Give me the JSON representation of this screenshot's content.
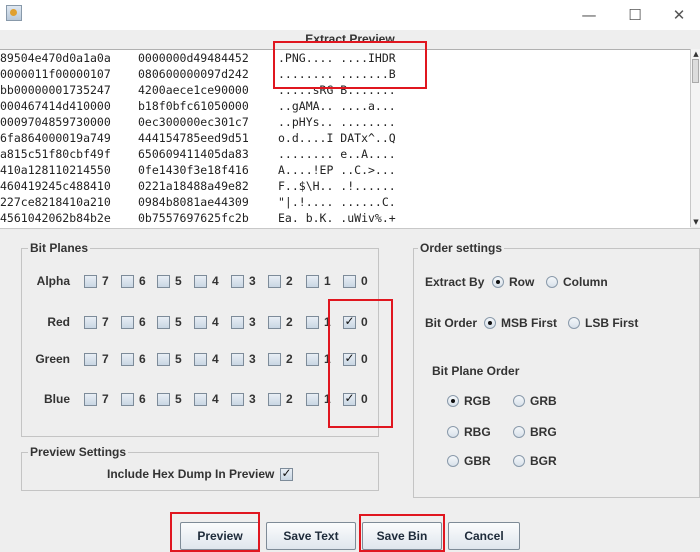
{
  "window": {
    "min_glyph": "—",
    "max_glyph": "☐",
    "close_glyph": "✕"
  },
  "preview": {
    "title": "Extract Preview",
    "rows": [
      [
        "89504e470d0a1a0a",
        "0000000d49484452",
        ".PNG.... ....IHDR"
      ],
      [
        "0000011f00000107",
        "080600000097d242",
        "........ .......B"
      ],
      [
        "bb00000001735247",
        "4200aece1ce90000",
        ".....sRG B......."
      ],
      [
        "000467414d410000",
        "b18f0bfc61050000",
        "..gAMA.. ....a..."
      ],
      [
        "0009704859730000",
        "0ec300000ec301c7",
        "..pHYs.. ........"
      ],
      [
        "6fa864000019a749",
        "444154785eed9d51",
        "o.d....I DATx^..Q"
      ],
      [
        "a815c51f80cbf49f",
        "650609411405da83",
        "........ e..A...."
      ],
      [
        "410a128110214550",
        "0fe1430f3e18f416",
        "A....!EP ..C.>..."
      ],
      [
        "460419245c488410",
        "0221a18488a49e82",
        "F..$\\H.. .!......"
      ],
      [
        "227ce8218410a210",
        "0984b8081ae44309",
        "\"|.!.... ......C."
      ],
      [
        "4561042062b84b2e",
        "0b7557697625fc2b",
        "Ea. b.K. .uWiv%.+"
      ]
    ]
  },
  "bit_planes": {
    "title": "Bit Planes",
    "bits": [
      "7",
      "6",
      "5",
      "4",
      "3",
      "2",
      "1",
      "0"
    ],
    "channels": [
      {
        "label": "Alpha",
        "checked": [
          false,
          false,
          false,
          false,
          false,
          false,
          false,
          false
        ]
      },
      {
        "label": "Red",
        "checked": [
          false,
          false,
          false,
          false,
          false,
          false,
          false,
          true
        ]
      },
      {
        "label": "Green",
        "checked": [
          false,
          false,
          false,
          false,
          false,
          false,
          false,
          true
        ]
      },
      {
        "label": "Blue",
        "checked": [
          false,
          false,
          false,
          false,
          false,
          false,
          false,
          true
        ]
      }
    ]
  },
  "order_settings": {
    "title": "Order settings",
    "extract_by_label": "Extract By",
    "extract_by": {
      "row": "Row",
      "column": "Column",
      "selected": "row"
    },
    "bit_order_label": "Bit Order",
    "bit_order": {
      "msb": "MSB First",
      "lsb": "LSB First",
      "selected": "msb"
    },
    "plane_order_label": "Bit Plane Order",
    "plane_order": {
      "options": [
        "RGB",
        "GRB",
        "RBG",
        "BRG",
        "GBR",
        "BGR"
      ],
      "selected": "RGB"
    }
  },
  "preview_settings": {
    "title": "Preview Settings",
    "hex_dump_label": "Include Hex Dump In Preview",
    "hex_dump_checked": true
  },
  "buttons": {
    "preview": "Preview",
    "save_text": "Save Text",
    "save_bin": "Save Bin",
    "cancel": "Cancel"
  },
  "annotation_color": "#e0161f"
}
